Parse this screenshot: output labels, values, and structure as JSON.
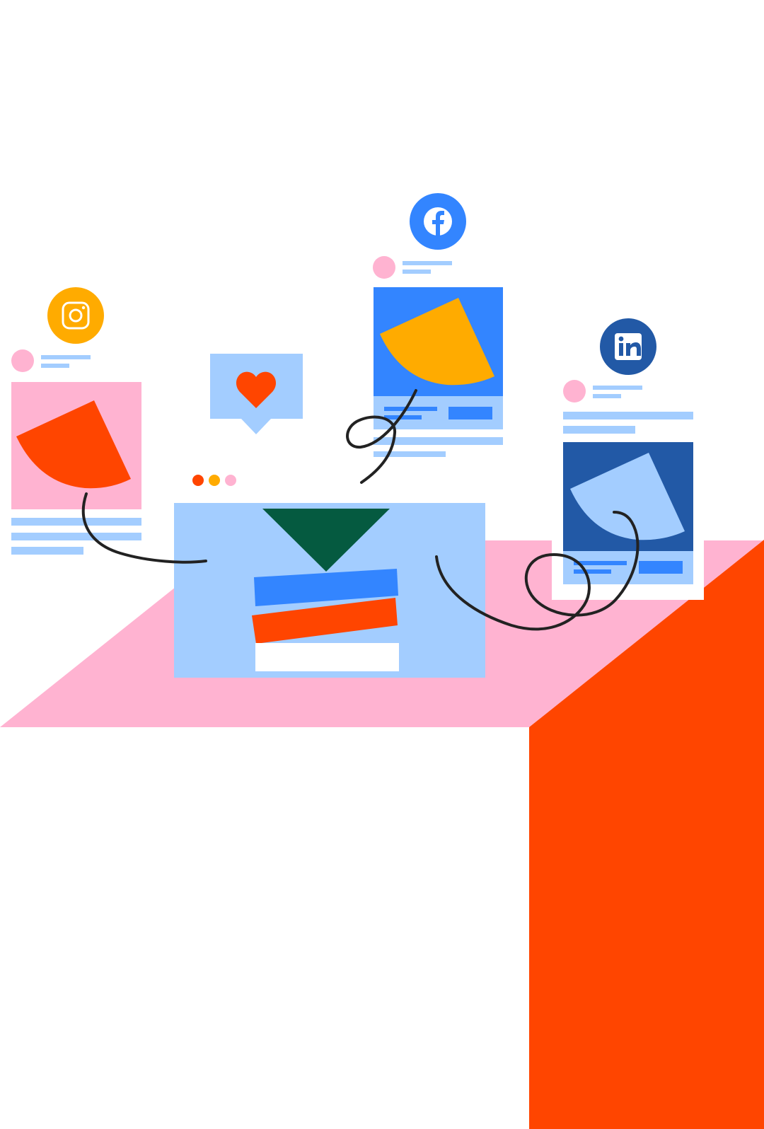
{
  "illustration": {
    "theme": "social-media-posts",
    "icons": [
      "instagram-icon",
      "facebook-icon",
      "linkedin-icon",
      "heart-icon",
      "more-dots-icon"
    ],
    "colors": {
      "background": "#ffffff",
      "pink": "#ffb3d1",
      "light_blue": "#a3cdff",
      "blue": "#3385ff",
      "dark_blue": "#2259a6",
      "orange_red": "#ff4500",
      "amber": "#ffab00",
      "dark_green": "#055a40",
      "ink": "#222222"
    }
  }
}
